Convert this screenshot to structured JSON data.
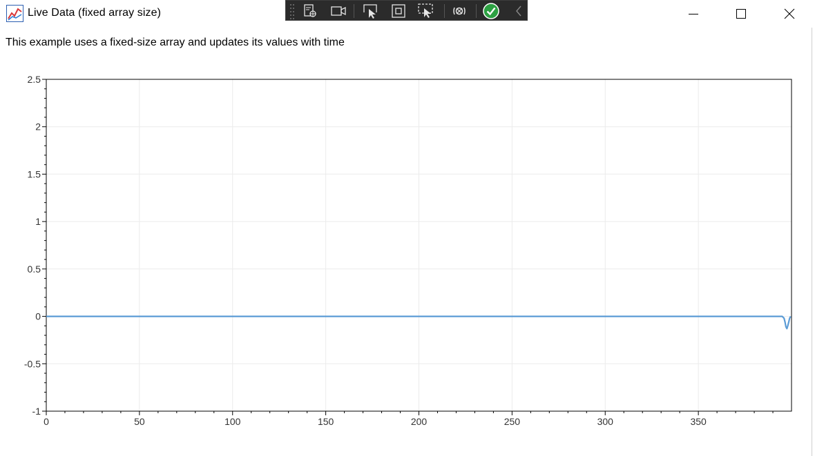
{
  "window": {
    "title": "Live Data (fixed array size)",
    "description": "This example uses a fixed-size array and updates its values with time",
    "controls": [
      "minimize",
      "maximize",
      "close"
    ]
  },
  "debug_toolbar": {
    "tools": [
      "visual-tree-icon",
      "camera-icon",
      "select-element-icon",
      "display-layout-adorners-icon",
      "track-focus-icon",
      "hot-reload-icon",
      "binding-ok-icon",
      "collapse-chevron-icon"
    ]
  },
  "colors": {
    "series": "#5b9bd5",
    "grid": "#ebebeb",
    "axis": "#000000",
    "debug_bg": "#2b2b2b",
    "ok_badge": "#2ca042"
  },
  "chart_data": {
    "type": "line",
    "title": "",
    "xlabel": "",
    "ylabel": "",
    "xlim": [
      0,
      400
    ],
    "ylim": [
      -1,
      2.5
    ],
    "xticks": [
      0,
      50,
      100,
      150,
      200,
      250,
      300,
      350
    ],
    "xtick_labels": [
      "0",
      "50",
      "100",
      "150",
      "200",
      "250",
      "300",
      "350"
    ],
    "yticks": [
      -1,
      -0.5,
      0,
      0.5,
      1,
      1.5,
      2,
      2.5
    ],
    "ytick_labels": [
      "-1",
      "-0.5",
      "0",
      "0.5",
      "1",
      "1.5",
      "2",
      "2.5"
    ],
    "grid": true,
    "series": [
      {
        "x": [
          0,
          50,
          100,
          150,
          200,
          250,
          300,
          350,
          395,
          396,
          396.5,
          397,
          397.5,
          398,
          398.5,
          399,
          399.5
        ],
        "y": [
          0,
          0,
          0,
          0,
          0,
          0,
          0,
          0,
          0,
          -0.02,
          -0.06,
          -0.11,
          -0.13,
          -0.1,
          -0.06,
          -0.02,
          0
        ]
      }
    ]
  }
}
